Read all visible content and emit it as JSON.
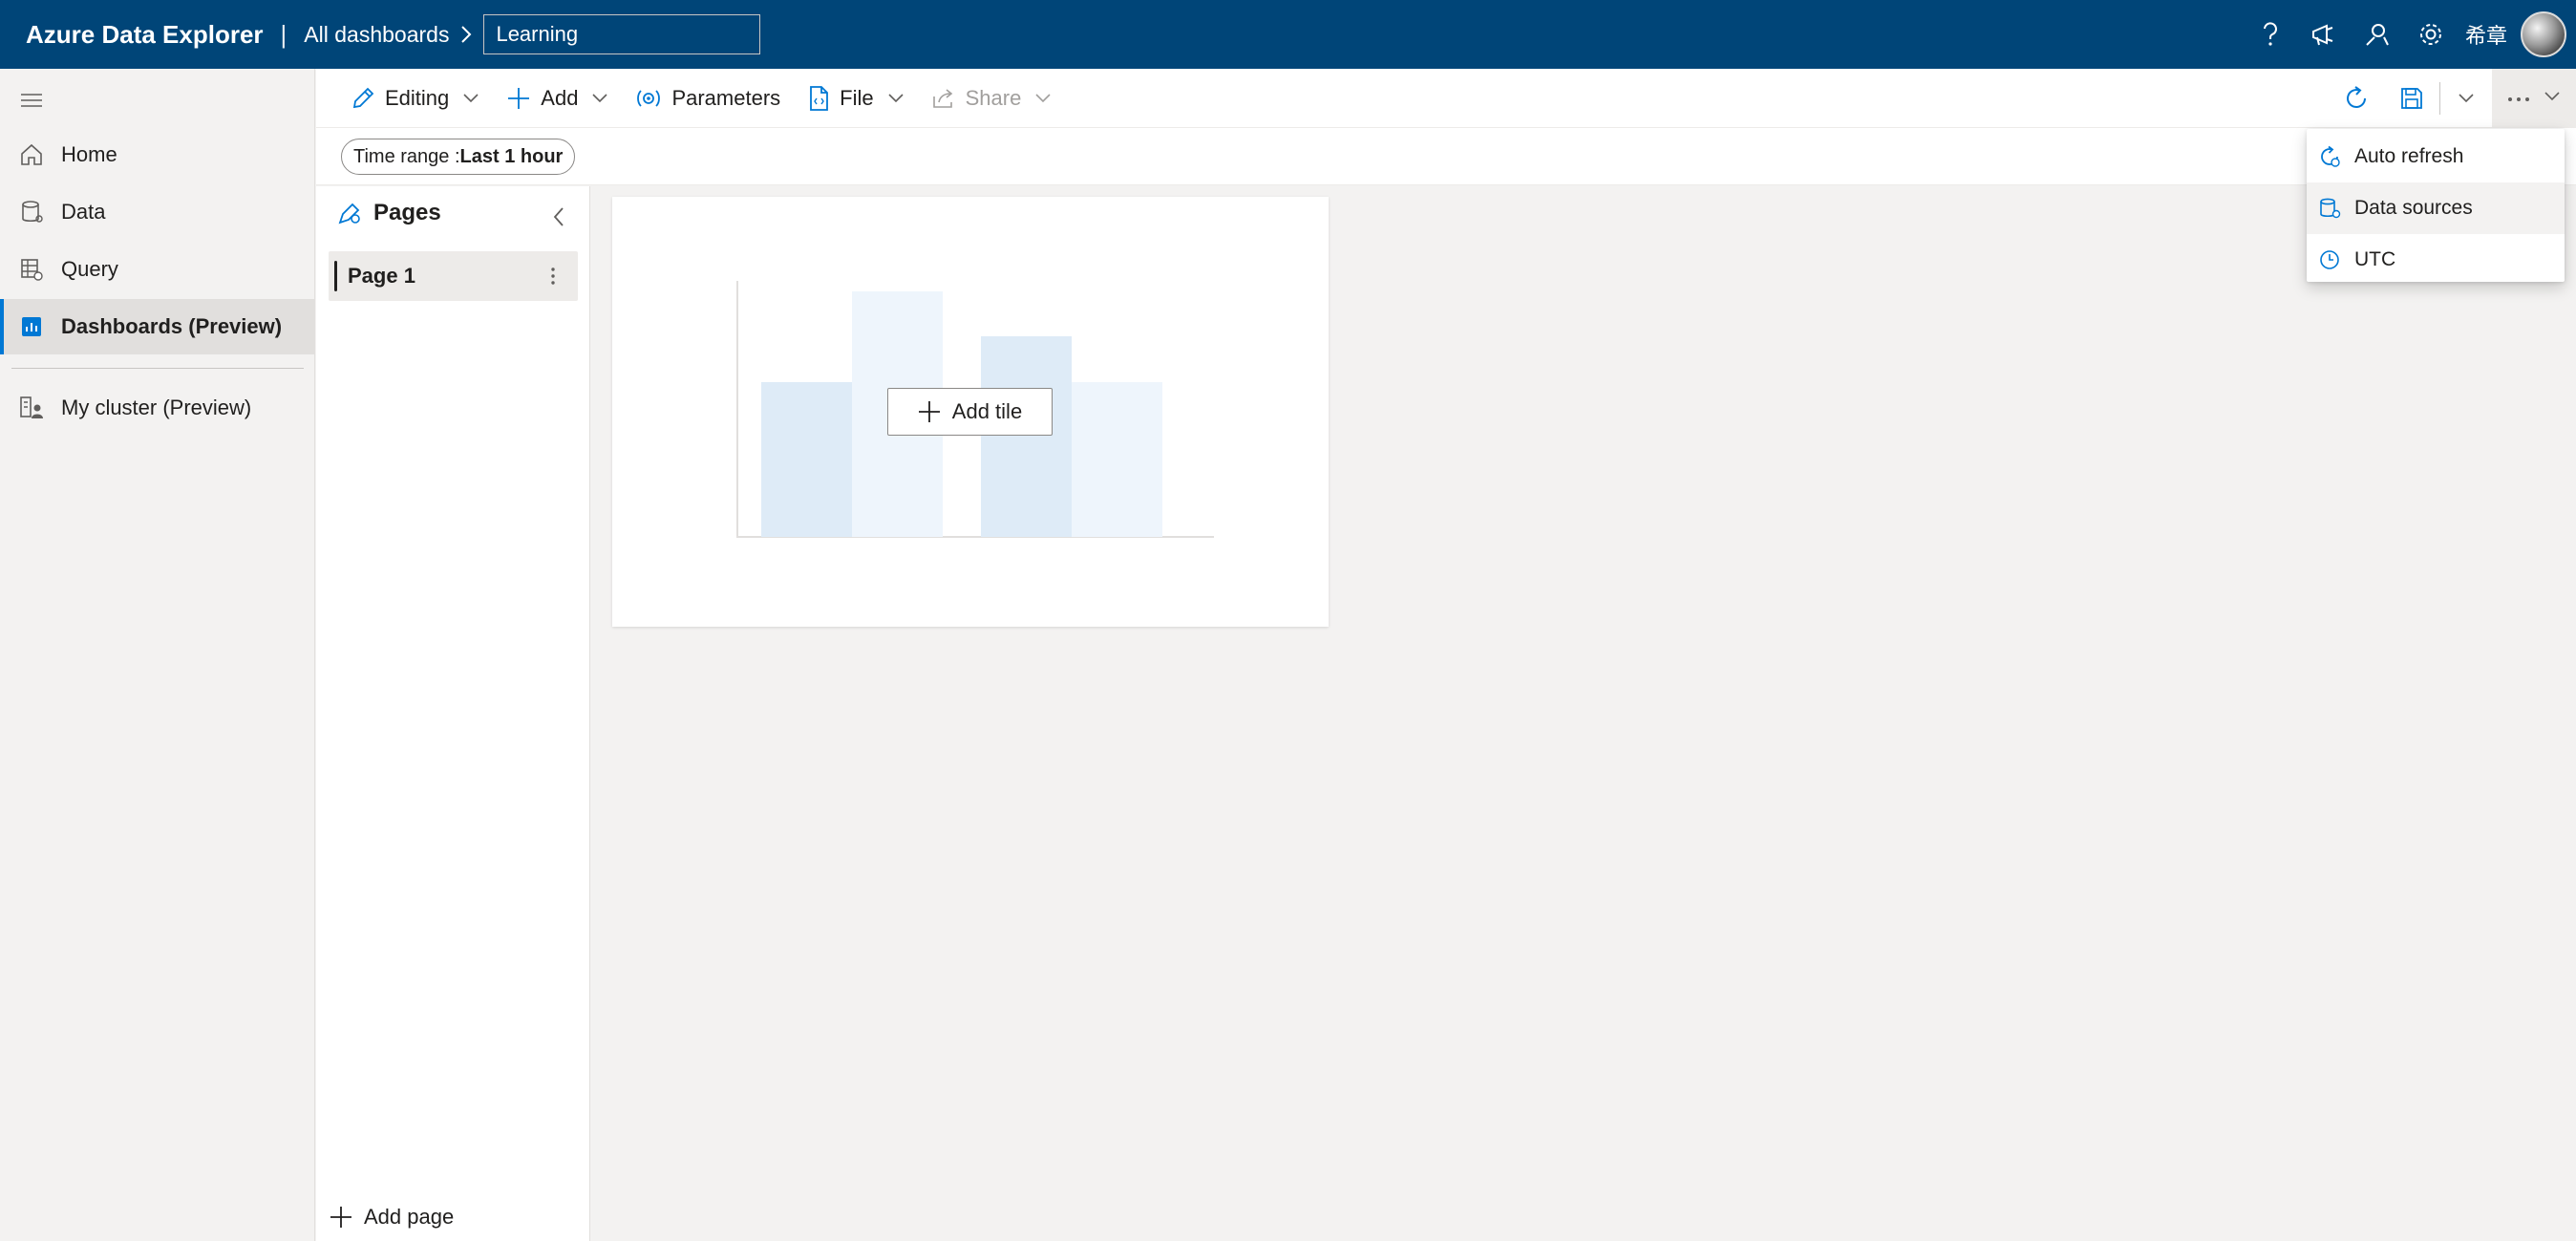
{
  "header": {
    "brand": "Azure Data Explorer",
    "separator": "|",
    "breadcrumb_root": "All dashboards",
    "dashboard_name": "Learning",
    "user_name": "希章"
  },
  "leftnav": {
    "items": [
      {
        "label": "Home",
        "icon": "home-icon"
      },
      {
        "label": "Data",
        "icon": "database-icon"
      },
      {
        "label": "Query",
        "icon": "query-icon"
      },
      {
        "label": "Dashboards (Preview)",
        "icon": "dashboard-icon",
        "active": true
      },
      {
        "label": "My cluster (Preview)",
        "icon": "cluster-icon"
      }
    ]
  },
  "toolbar": {
    "editing_label": "Editing",
    "add_label": "Add",
    "parameters_label": "Parameters",
    "file_label": "File",
    "share_label": "Share"
  },
  "filters": {
    "time_range_label": "Time range : ",
    "time_range_value": "Last 1 hour"
  },
  "pages_panel": {
    "title": "Pages",
    "pages": [
      {
        "label": "Page 1",
        "selected": true
      }
    ],
    "add_page_label": "Add page"
  },
  "canvas": {
    "add_tile_label": "Add tile"
  },
  "more_menu": {
    "items": [
      {
        "label": "Auto refresh",
        "icon": "auto-refresh-icon"
      },
      {
        "label": "Data sources",
        "icon": "data-sources-icon",
        "hover": true
      },
      {
        "label": "UTC",
        "icon": "clock-icon"
      }
    ]
  },
  "colors": {
    "header_bg": "#004578",
    "accent": "#0078d4",
    "placeholder_bar_dark": "#deebf7",
    "placeholder_bar_light": "#eef5fc"
  }
}
